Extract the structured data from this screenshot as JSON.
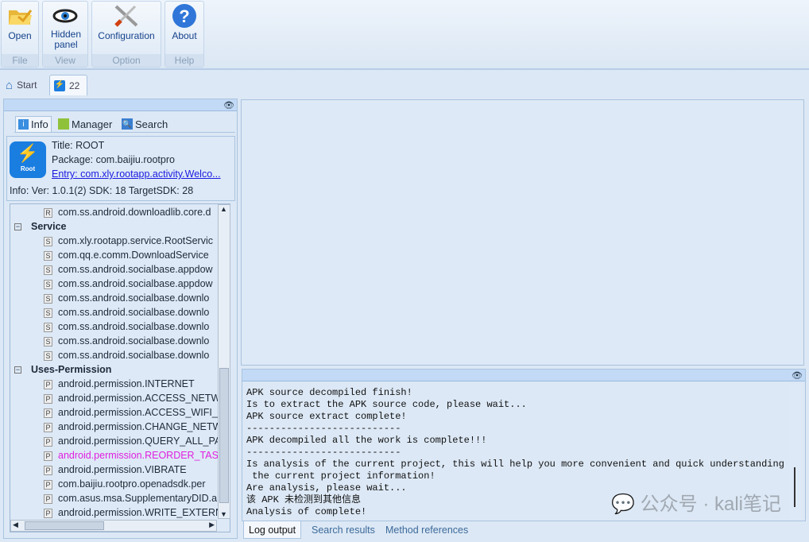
{
  "ribbon": {
    "groups": [
      {
        "button": "Open",
        "caption": "File",
        "icon": "folder-icon"
      },
      {
        "button": "Hidden panel",
        "caption": "View",
        "icon": "eye-icon"
      },
      {
        "button": "Configuration",
        "caption": "Option",
        "icon": "tools-icon"
      },
      {
        "button": "About",
        "caption": "Help",
        "icon": "help-icon"
      }
    ]
  },
  "tabs": [
    {
      "label": "Start",
      "icon": "home-icon"
    },
    {
      "label": "22",
      "icon": "root-app-icon"
    }
  ],
  "left": {
    "subtabs": [
      {
        "label": "Info"
      },
      {
        "label": "Manager"
      },
      {
        "label": "Search"
      }
    ],
    "info": {
      "title": "Title: ROOT",
      "package": "Package: com.baijiu.rootpro",
      "entry": "Entry: com.xly.rootapp.activity.Welco...",
      "meta": "Info: Ver:  1.0.1(2) SDK:  18 TargetSDK:  28",
      "logo_text": "Root"
    },
    "tree": [
      {
        "type": "R",
        "text": "com.ss.android.downloadlib.core.d"
      },
      {
        "type": "group",
        "text": "Service"
      },
      {
        "type": "S",
        "text": "com.xly.rootapp.service.RootServic"
      },
      {
        "type": "S",
        "text": "com.qq.e.comm.DownloadService"
      },
      {
        "type": "S",
        "text": "com.ss.android.socialbase.appdow"
      },
      {
        "type": "S",
        "text": "com.ss.android.socialbase.appdow"
      },
      {
        "type": "S",
        "text": "com.ss.android.socialbase.downlo"
      },
      {
        "type": "S",
        "text": "com.ss.android.socialbase.downlo"
      },
      {
        "type": "S",
        "text": "com.ss.android.socialbase.downlo"
      },
      {
        "type": "S",
        "text": "com.ss.android.socialbase.downlo"
      },
      {
        "type": "S",
        "text": "com.ss.android.socialbase.downlo"
      },
      {
        "type": "group",
        "text": "Uses-Permission"
      },
      {
        "type": "P",
        "text": "android.permission.INTERNET"
      },
      {
        "type": "P",
        "text": "android.permission.ACCESS_NETW"
      },
      {
        "type": "P",
        "text": "android.permission.ACCESS_WIFI_"
      },
      {
        "type": "P",
        "text": "android.permission.CHANGE_NETW"
      },
      {
        "type": "P",
        "text": "android.permission.QUERY_ALL_PA"
      },
      {
        "type": "P",
        "text": "android.permission.REORDER_TAS",
        "highlight": "#e020e0"
      },
      {
        "type": "P",
        "text": "android.permission.VIBRATE"
      },
      {
        "type": "P",
        "text": "com.baijiu.rootpro.openadsdk.per"
      },
      {
        "type": "P",
        "text": "com.asus.msa.SupplementaryDID.a"
      },
      {
        "type": "P",
        "text": "android.permission.WRITE_EXTERN"
      }
    ]
  },
  "log": {
    "lines": [
      "APK source decompiled finish!",
      "Is to extract the APK source code, please wait...",
      "APK source extract complete!",
      "---------------------------",
      "APK decompiled all the work is complete!!!",
      "---------------------------",
      "Is analysis of the current project, this will help you more convenient and quick understanding of",
      " the current project information!",
      "Are analysis, please wait...",
      "该 APK 未检测到其他信息",
      "Analysis of complete!"
    ],
    "tabs": [
      "Log output",
      "Search results",
      "Method references"
    ]
  },
  "watermark": "公众号 · kali笔记"
}
